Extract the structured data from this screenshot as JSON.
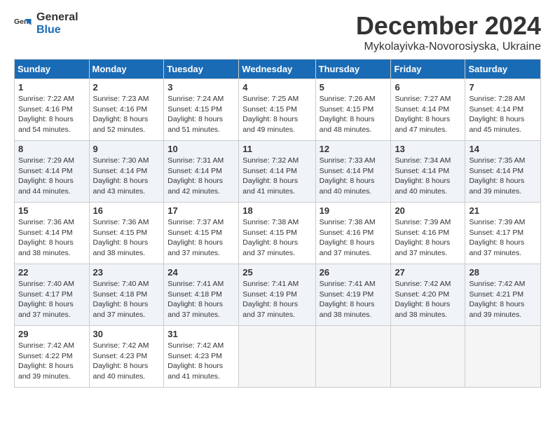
{
  "logo": {
    "general": "General",
    "blue": "Blue"
  },
  "title": "December 2024",
  "location": "Mykolayivka-Novorosiyska, Ukraine",
  "weekdays": [
    "Sunday",
    "Monday",
    "Tuesday",
    "Wednesday",
    "Thursday",
    "Friday",
    "Saturday"
  ],
  "weeks": [
    [
      {
        "day": "1",
        "sunrise": "7:22 AM",
        "sunset": "4:16 PM",
        "daylight": "8 hours and 54 minutes."
      },
      {
        "day": "2",
        "sunrise": "7:23 AM",
        "sunset": "4:16 PM",
        "daylight": "8 hours and 52 minutes."
      },
      {
        "day": "3",
        "sunrise": "7:24 AM",
        "sunset": "4:15 PM",
        "daylight": "8 hours and 51 minutes."
      },
      {
        "day": "4",
        "sunrise": "7:25 AM",
        "sunset": "4:15 PM",
        "daylight": "8 hours and 49 minutes."
      },
      {
        "day": "5",
        "sunrise": "7:26 AM",
        "sunset": "4:15 PM",
        "daylight": "8 hours and 48 minutes."
      },
      {
        "day": "6",
        "sunrise": "7:27 AM",
        "sunset": "4:14 PM",
        "daylight": "8 hours and 47 minutes."
      },
      {
        "day": "7",
        "sunrise": "7:28 AM",
        "sunset": "4:14 PM",
        "daylight": "8 hours and 45 minutes."
      }
    ],
    [
      {
        "day": "8",
        "sunrise": "7:29 AM",
        "sunset": "4:14 PM",
        "daylight": "8 hours and 44 minutes."
      },
      {
        "day": "9",
        "sunrise": "7:30 AM",
        "sunset": "4:14 PM",
        "daylight": "8 hours and 43 minutes."
      },
      {
        "day": "10",
        "sunrise": "7:31 AM",
        "sunset": "4:14 PM",
        "daylight": "8 hours and 42 minutes."
      },
      {
        "day": "11",
        "sunrise": "7:32 AM",
        "sunset": "4:14 PM",
        "daylight": "8 hours and 41 minutes."
      },
      {
        "day": "12",
        "sunrise": "7:33 AM",
        "sunset": "4:14 PM",
        "daylight": "8 hours and 40 minutes."
      },
      {
        "day": "13",
        "sunrise": "7:34 AM",
        "sunset": "4:14 PM",
        "daylight": "8 hours and 40 minutes."
      },
      {
        "day": "14",
        "sunrise": "7:35 AM",
        "sunset": "4:14 PM",
        "daylight": "8 hours and 39 minutes."
      }
    ],
    [
      {
        "day": "15",
        "sunrise": "7:36 AM",
        "sunset": "4:14 PM",
        "daylight": "8 hours and 38 minutes."
      },
      {
        "day": "16",
        "sunrise": "7:36 AM",
        "sunset": "4:15 PM",
        "daylight": "8 hours and 38 minutes."
      },
      {
        "day": "17",
        "sunrise": "7:37 AM",
        "sunset": "4:15 PM",
        "daylight": "8 hours and 37 minutes."
      },
      {
        "day": "18",
        "sunrise": "7:38 AM",
        "sunset": "4:15 PM",
        "daylight": "8 hours and 37 minutes."
      },
      {
        "day": "19",
        "sunrise": "7:38 AM",
        "sunset": "4:16 PM",
        "daylight": "8 hours and 37 minutes."
      },
      {
        "day": "20",
        "sunrise": "7:39 AM",
        "sunset": "4:16 PM",
        "daylight": "8 hours and 37 minutes."
      },
      {
        "day": "21",
        "sunrise": "7:39 AM",
        "sunset": "4:17 PM",
        "daylight": "8 hours and 37 minutes."
      }
    ],
    [
      {
        "day": "22",
        "sunrise": "7:40 AM",
        "sunset": "4:17 PM",
        "daylight": "8 hours and 37 minutes."
      },
      {
        "day": "23",
        "sunrise": "7:40 AM",
        "sunset": "4:18 PM",
        "daylight": "8 hours and 37 minutes."
      },
      {
        "day": "24",
        "sunrise": "7:41 AM",
        "sunset": "4:18 PM",
        "daylight": "8 hours and 37 minutes."
      },
      {
        "day": "25",
        "sunrise": "7:41 AM",
        "sunset": "4:19 PM",
        "daylight": "8 hours and 37 minutes."
      },
      {
        "day": "26",
        "sunrise": "7:41 AM",
        "sunset": "4:19 PM",
        "daylight": "8 hours and 38 minutes."
      },
      {
        "day": "27",
        "sunrise": "7:42 AM",
        "sunset": "4:20 PM",
        "daylight": "8 hours and 38 minutes."
      },
      {
        "day": "28",
        "sunrise": "7:42 AM",
        "sunset": "4:21 PM",
        "daylight": "8 hours and 39 minutes."
      }
    ],
    [
      {
        "day": "29",
        "sunrise": "7:42 AM",
        "sunset": "4:22 PM",
        "daylight": "8 hours and 39 minutes."
      },
      {
        "day": "30",
        "sunrise": "7:42 AM",
        "sunset": "4:23 PM",
        "daylight": "8 hours and 40 minutes."
      },
      {
        "day": "31",
        "sunrise": "7:42 AM",
        "sunset": "4:23 PM",
        "daylight": "8 hours and 41 minutes."
      },
      null,
      null,
      null,
      null
    ]
  ]
}
